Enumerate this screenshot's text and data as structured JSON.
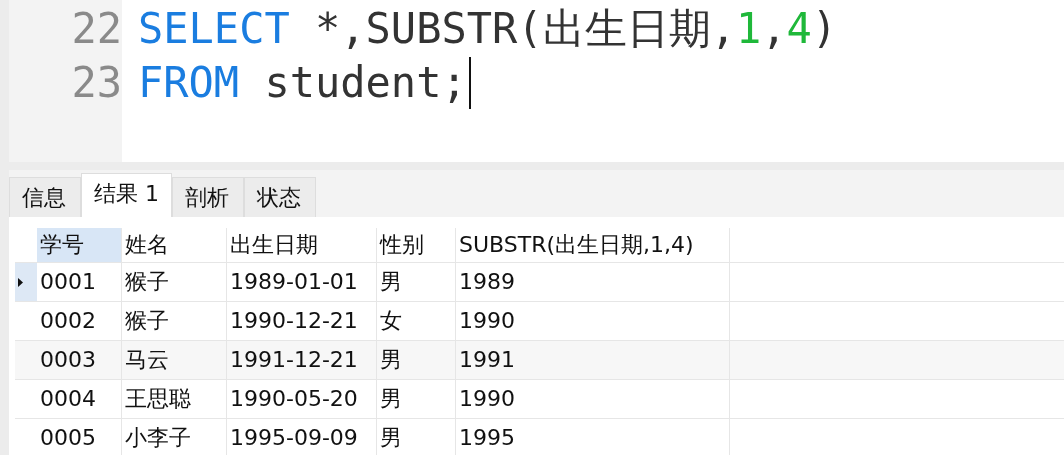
{
  "editor": {
    "lines": [
      {
        "number": "22",
        "caret": false,
        "tokens": [
          {
            "kind": "keyword",
            "text": "SELECT"
          },
          {
            "kind": "plain",
            "text": " *,SUBSTR(出生日期,"
          },
          {
            "kind": "number",
            "text": "1"
          },
          {
            "kind": "plain",
            "text": ","
          },
          {
            "kind": "number",
            "text": "4"
          },
          {
            "kind": "plain",
            "text": ")"
          }
        ]
      },
      {
        "number": "23",
        "caret": true,
        "tokens": [
          {
            "kind": "keyword",
            "text": "FROM"
          },
          {
            "kind": "plain",
            "text": " student;"
          }
        ]
      }
    ]
  },
  "tabs": [
    {
      "label": "信息",
      "selected": false
    },
    {
      "label": "结果 1",
      "selected": true
    },
    {
      "label": "剖析",
      "selected": false
    },
    {
      "label": "状态",
      "selected": false
    }
  ],
  "table": {
    "columns": [
      {
        "label": "学号",
        "selected": true
      },
      {
        "label": "姓名",
        "selected": false
      },
      {
        "label": "出生日期",
        "selected": false
      },
      {
        "label": "性别",
        "selected": false
      },
      {
        "label": "SUBSTR(出生日期,1,4)",
        "selected": false
      }
    ],
    "rows": [
      {
        "selected": true,
        "cells": [
          "0001",
          "猴子",
          "1989-01-01",
          "男",
          "1989"
        ]
      },
      {
        "selected": false,
        "cells": [
          "0002",
          "猴子",
          "1990-12-21",
          "女",
          "1990"
        ]
      },
      {
        "selected": false,
        "cells": [
          "0003",
          "马云",
          "1991-12-21",
          "男",
          "1991"
        ]
      },
      {
        "selected": false,
        "cells": [
          "0004",
          "王思聪",
          "1990-05-20",
          "男",
          "1990"
        ]
      },
      {
        "selected": false,
        "cells": [
          "0005",
          "小李子",
          "1995-09-09",
          "男",
          "1995"
        ]
      }
    ]
  }
}
